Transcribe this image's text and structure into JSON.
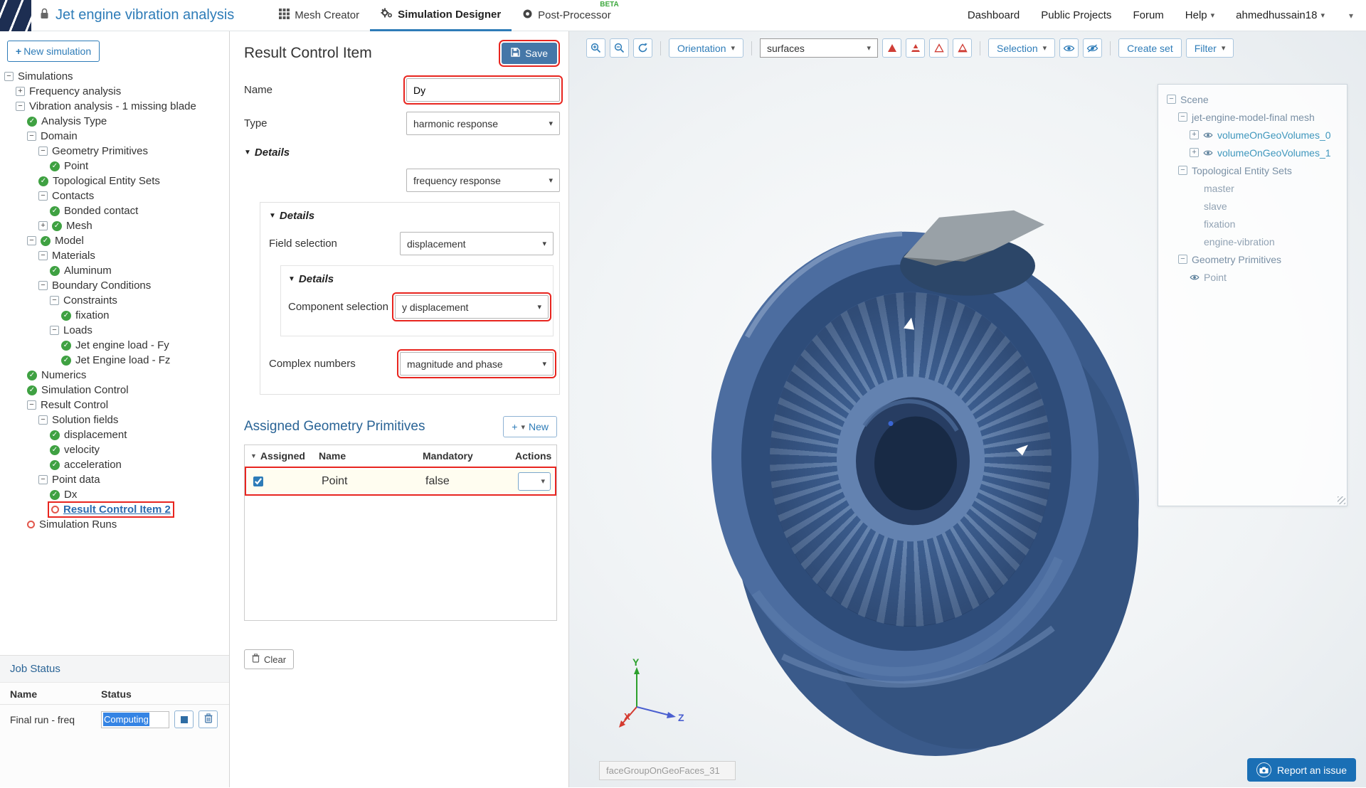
{
  "topbar": {
    "title": "Jet engine vibration analysis",
    "tabs": [
      {
        "label": "Mesh Creator"
      },
      {
        "label": "Simulation Designer"
      },
      {
        "label": "Post-Processor",
        "badge": "BETA"
      }
    ],
    "nav": [
      "Dashboard",
      "Public Projects",
      "Forum",
      "Help"
    ],
    "user": "ahmedhussain18"
  },
  "icons": {
    "collapse": "−",
    "expand": "+",
    "plus": "+",
    "caret_down": "▾",
    "triangle_down": "▼",
    "check": "✓"
  },
  "sidebar": {
    "new_simulation_label": "New simulation",
    "tree": [
      {
        "label": "Simulations",
        "level": 0,
        "expander": "minus"
      },
      {
        "label": "Frequency analysis",
        "level": 1,
        "expander": "plus"
      },
      {
        "label": "Vibration analysis - 1 missing blade",
        "level": 1,
        "expander": "minus"
      },
      {
        "label": "Analysis Type",
        "level": 2,
        "status": "check"
      },
      {
        "label": "Domain",
        "level": 2,
        "expander": "minus"
      },
      {
        "label": "Geometry Primitives",
        "level": 3,
        "expander": "minus"
      },
      {
        "label": "Point",
        "level": 4,
        "status": "check"
      },
      {
        "label": "Topological Entity Sets",
        "level": 3,
        "status": "check"
      },
      {
        "label": "Contacts",
        "level": 3,
        "expander": "minus"
      },
      {
        "label": "Bonded contact",
        "level": 4,
        "status": "check"
      },
      {
        "label": "Mesh",
        "level": 3,
        "expander": "plus",
        "status": "check"
      },
      {
        "label": "Model",
        "level": 2,
        "expander": "minus",
        "status": "check"
      },
      {
        "label": "Materials",
        "level": 3,
        "expander": "minus"
      },
      {
        "label": "Aluminum",
        "level": 4,
        "status": "check"
      },
      {
        "label": "Boundary Conditions",
        "level": 3,
        "expander": "minus"
      },
      {
        "label": "Constraints",
        "level": 4,
        "expander": "minus"
      },
      {
        "label": "fixation",
        "level": 5,
        "status": "check"
      },
      {
        "label": "Loads",
        "level": 4,
        "expander": "minus"
      },
      {
        "label": "Jet engine load - Fy",
        "level": 5,
        "status": "check"
      },
      {
        "label": "Jet Engine load - Fz",
        "level": 5,
        "status": "check"
      },
      {
        "label": "Numerics",
        "level": 2,
        "status": "check"
      },
      {
        "label": "Simulation Control",
        "level": 2,
        "status": "check"
      },
      {
        "label": "Result Control",
        "level": 2,
        "expander": "minus"
      },
      {
        "label": "Solution fields",
        "level": 3,
        "expander": "minus"
      },
      {
        "label": "displacement",
        "level": 4,
        "status": "check"
      },
      {
        "label": "velocity",
        "level": 4,
        "status": "check"
      },
      {
        "label": "acceleration",
        "level": 4,
        "status": "check"
      },
      {
        "label": "Point data",
        "level": 3,
        "expander": "minus"
      },
      {
        "label": "Dx",
        "level": 4,
        "status": "check"
      },
      {
        "label": "Result Control Item 2",
        "level": 4,
        "status": "circle",
        "highlighted": true
      },
      {
        "label": "Simulation Runs",
        "level": 2,
        "status": "circle"
      }
    ],
    "job_status": {
      "title": "Job Status",
      "headers": [
        "Name",
        "Status"
      ],
      "rows": [
        {
          "name": "Final run - freq",
          "status": "Computing"
        }
      ]
    }
  },
  "form": {
    "title": "Result Control Item",
    "save_label": "Save",
    "name_label": "Name",
    "name_value": "Dy",
    "type_label": "Type",
    "type_value": "harmonic response",
    "details_label": "Details",
    "details1_value": "frequency response",
    "field_selection_label": "Field selection",
    "field_selection_value": "displacement",
    "component_label": "Component selection",
    "component_value": "y displacement",
    "complex_label": "Complex numbers",
    "complex_value": "magnitude and phase",
    "assigned": {
      "title": "Assigned Geometry Primitives",
      "new_label": "New",
      "headers": [
        "Assigned",
        "Name",
        "Mandatory",
        "Actions"
      ],
      "rows": [
        {
          "name": "Point",
          "mandatory": "false"
        }
      ]
    },
    "clear_label": "Clear"
  },
  "viewport": {
    "toolbar": {
      "orientation_label": "Orientation",
      "surfaces_value": "surfaces",
      "selection_label": "Selection",
      "create_set_label": "Create set",
      "filter_label": "Filter"
    },
    "scene_tree": [
      {
        "label": "Scene",
        "level": 0,
        "expander": "minus"
      },
      {
        "label": "jet-engine-model-final mesh",
        "level": 1,
        "expander": "minus"
      },
      {
        "label": "volumeOnGeoVolumes_0",
        "level": 2,
        "expander": "plus",
        "eye": true
      },
      {
        "label": "volumeOnGeoVolumes_1",
        "level": 2,
        "expander": "plus",
        "eye": true
      },
      {
        "label": "Topological Entity Sets",
        "level": 1,
        "expander": "minus"
      },
      {
        "label": "master",
        "level": 2
      },
      {
        "label": "slave",
        "level": 2
      },
      {
        "label": "fixation",
        "level": 2
      },
      {
        "label": "engine-vibration",
        "level": 2
      },
      {
        "label": "Geometry Primitives",
        "level": 1,
        "expander": "minus"
      },
      {
        "label": "Point",
        "level": 2,
        "eye": true
      }
    ],
    "axes": {
      "x": "X",
      "y": "Y",
      "z": "Z"
    },
    "face_label": "faceGroupOnGeoFaces_31",
    "report_issue_label": "Report an issue"
  },
  "colors": {
    "accent_blue": "#2e7cb8",
    "annotation_red": "#e8251f",
    "check_green": "#3fa142",
    "engine_blue": "#46689c",
    "beta_green": "#3da83d"
  }
}
